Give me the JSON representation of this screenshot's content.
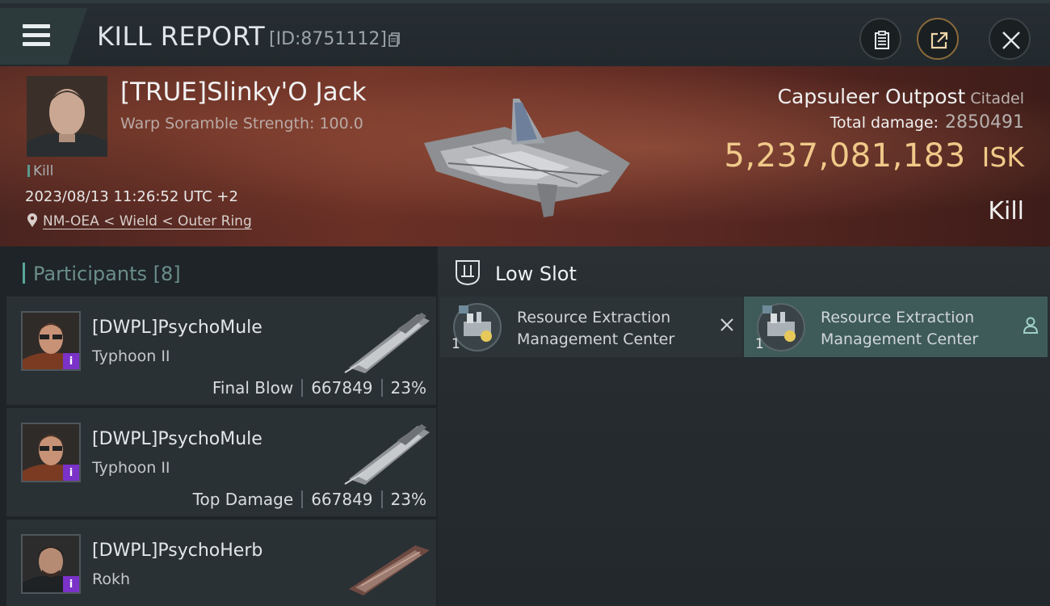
{
  "header": {
    "title": "KILL REPORT",
    "kill_id": "[ID:8751112]",
    "menu_icon": "hamburger-icon",
    "buttons": [
      {
        "name": "clipboard-icon"
      },
      {
        "name": "share-icon"
      },
      {
        "name": "close-icon"
      }
    ]
  },
  "victim": {
    "name": "[TRUE]Slinky'O Jack",
    "warp_scramble": "Warp Soramble Strength: 100.0",
    "tag": "Kill",
    "datetime": "2023/08/13 11:26:52 UTC +2",
    "location": "NM-OEA < Wield < Outer Ring",
    "structure_name": "Capsuleer Outpost",
    "structure_class": "Citadel",
    "total_damage_label": "Total damage:",
    "total_damage_value": "2850491",
    "isk_value": "5,237,081,183",
    "isk_unit": "ISK",
    "result": "Kill"
  },
  "participants": {
    "label": "Participants",
    "count": "[8]",
    "items": [
      {
        "name": "[DWPL]PsychoMule",
        "ship": "Typhoon II",
        "role": "Final Blow",
        "damage": "667849",
        "percent": "23%"
      },
      {
        "name": "[DWPL]PsychoMule",
        "ship": "Typhoon II",
        "role": "Top Damage",
        "damage": "667849",
        "percent": "23%"
      },
      {
        "name": "[DWPL]PsychoHerb",
        "ship": "Rokh",
        "role": "",
        "damage": "",
        "percent": ""
      }
    ]
  },
  "low_slot": {
    "title": "Low Slot",
    "items": [
      {
        "name_line1": "Resource Extraction",
        "name_line2": "Management Center",
        "count": "1",
        "status": "destroyed",
        "action_icon": "close-icon"
      },
      {
        "name_line1": "Resource Extraction",
        "name_line2": "Management Center",
        "count": "1",
        "status": "dropped",
        "action_icon": "person-icon"
      }
    ]
  },
  "colors": {
    "accent_teal": "#5aa79a",
    "isk_gold": "#f0c989",
    "dropped_item_bg": "#3e5b59",
    "destroyed_item_bg": "#2d3437",
    "badge_purple": "#7a32c9"
  }
}
